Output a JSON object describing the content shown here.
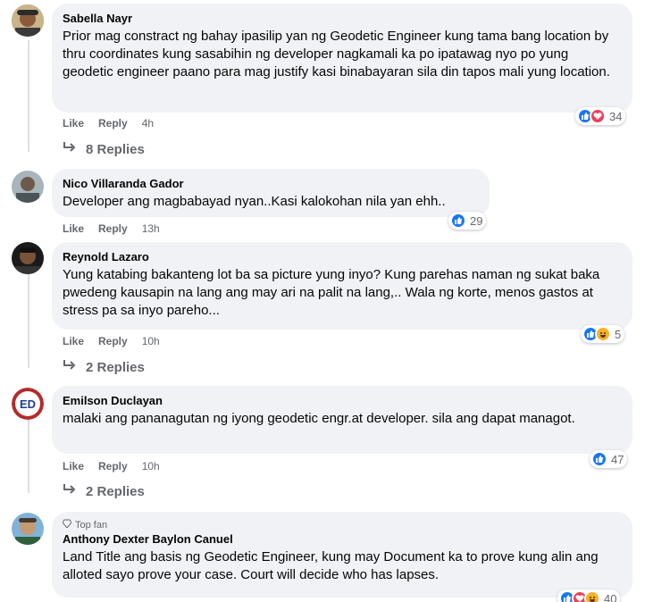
{
  "comments": [
    {
      "author": "Sabella Nayr",
      "text": "Prior mag constract ng bahay ipasilip yan ng Geodetic Engineer kung tama bang location by thru coordinates kung sasabihin ng developer nagkamali ka po ipatawag nyo po yung geodetic engineer paano para mag justify kasi binabayaran sila din tapos mali yung location.",
      "like": "Like",
      "reply": "Reply",
      "time": "4h",
      "reaction_count": "34",
      "reactions": [
        "like-icon",
        "love-icon"
      ],
      "replies": "8 Replies"
    },
    {
      "author": "Nico Villaranda Gador",
      "text": "Developer ang magbabayad nyan..Kasi kalokohan nila yan ehh..",
      "like": "Like",
      "reply": "Reply",
      "time": "13h",
      "reaction_count": "29",
      "reactions": [
        "like-icon"
      ]
    },
    {
      "author": "Reynold Lazaro",
      "text": "Yung katabing bakanteng lot ba sa picture yung inyo? Kung parehas naman ng sukat baka pwedeng kausapin na lang ang may ari na palit na lang,.. Wala ng korte, menos gastos at stress pa sa inyo pareho...",
      "like": "Like",
      "reply": "Reply",
      "time": "10h",
      "reaction_count": "5",
      "reactions": [
        "like-icon",
        "haha-icon"
      ],
      "replies": "2 Replies"
    },
    {
      "author": "Emilson Duclayan",
      "text": "malaki ang pananagutan ng iyong geodetic engr.at developer. sila ang dapat managot.",
      "like": "Like",
      "reply": "Reply",
      "time": "10h",
      "reaction_count": "47",
      "reactions": [
        "like-icon"
      ],
      "replies": "2 Replies"
    },
    {
      "badge": "Top fan",
      "author": "Anthony Dexter Baylon Canuel",
      "text": "Land Title ang basis ng Geodetic Engineer, kung may Document ka to prove kung alin ang alloted sayo prove your case. Court will decide who has lapses.",
      "reaction_count": "40",
      "reactions": [
        "like-icon",
        "love-icon",
        "haha-icon"
      ]
    }
  ],
  "colors": {
    "bubble": "#f0f2f5",
    "meta": "#65676b",
    "like": "#1877f2",
    "love": "#f33e58",
    "haha": "#f7b125"
  }
}
